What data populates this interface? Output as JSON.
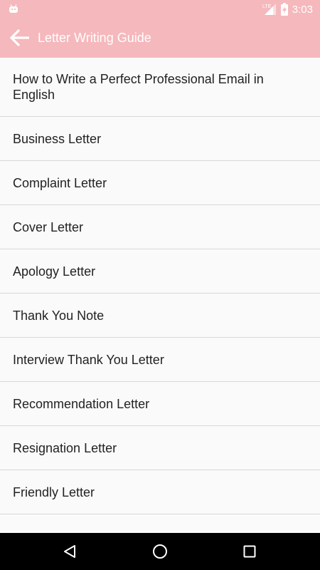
{
  "status_bar": {
    "network": "LTE",
    "time": "3:03"
  },
  "app_bar": {
    "title": "Letter Writing Guide",
    "background_color": "#f5b8bc"
  },
  "list": {
    "items": [
      {
        "label": "How to Write a Perfect Professional Email in English"
      },
      {
        "label": "Business Letter"
      },
      {
        "label": "Complaint Letter"
      },
      {
        "label": "Cover Letter"
      },
      {
        "label": "Apology Letter"
      },
      {
        "label": "Thank You Note"
      },
      {
        "label": "Interview Thank You Letter"
      },
      {
        "label": "Recommendation Letter"
      },
      {
        "label": "Resignation Letter"
      },
      {
        "label": "Friendly Letter"
      }
    ]
  },
  "icons": {
    "status_left": "android-icon",
    "signal": "signal-icon",
    "battery": "battery-charging-icon",
    "back": "arrow-back-icon",
    "nav_back": "triangle-back-icon",
    "nav_home": "circle-home-icon",
    "nav_recents": "square-recents-icon"
  }
}
